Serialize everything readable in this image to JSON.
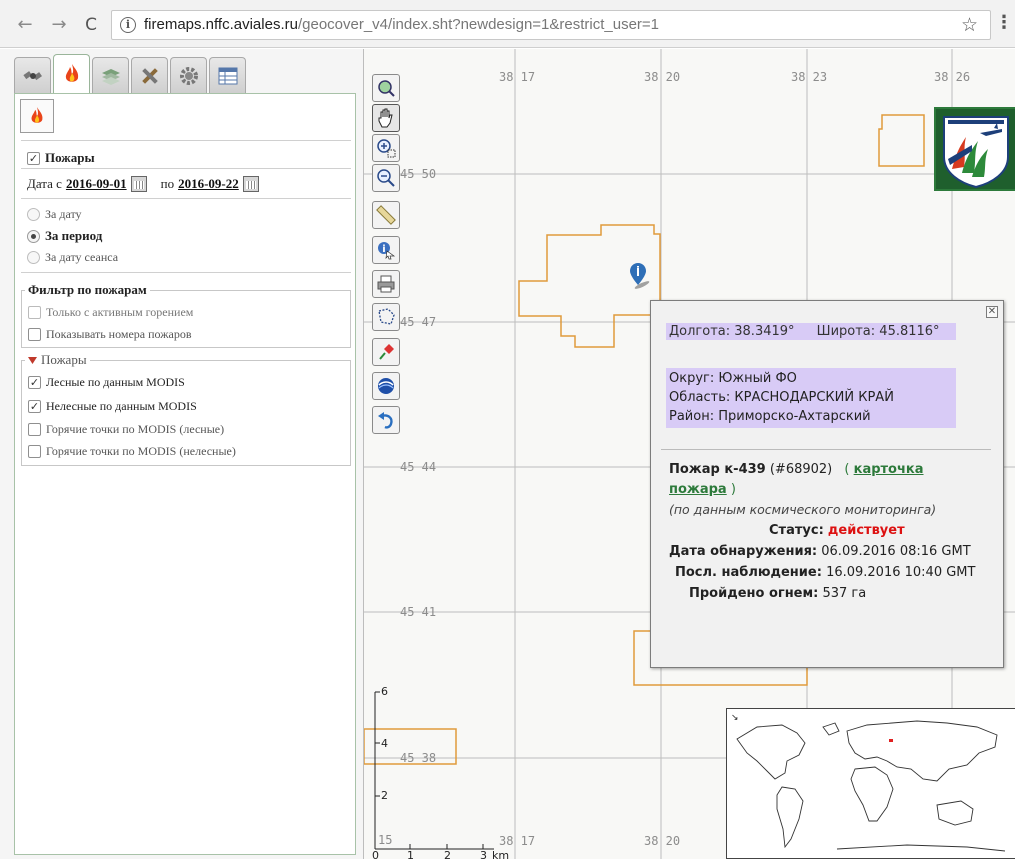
{
  "browser": {
    "url_host": "firemaps.nffc.aviales.ru",
    "url_path": "/geocover_v4/index.sht?newdesign=1&restrict_user=1"
  },
  "sidebar": {
    "tabs": [
      {
        "icon": "satellite-icon"
      },
      {
        "icon": "fire-icon",
        "active": true
      },
      {
        "icon": "layers-icon"
      },
      {
        "icon": "tools-icon"
      },
      {
        "icon": "gear-icon"
      },
      {
        "icon": "table-icon"
      }
    ],
    "fires_title": "Пожары",
    "date_from_label": "Дата с",
    "date_from": "2016-09-01",
    "date_to_label": "по",
    "date_to": "2016-09-22",
    "period_options": [
      {
        "label": "За дату",
        "selected": false
      },
      {
        "label": "За период",
        "selected": true
      },
      {
        "label": "За дату сеанса",
        "selected": false
      }
    ],
    "filter_legend": "Фильтр по пожарам",
    "filter_options": [
      {
        "label": "Только с активным горением",
        "checked": false,
        "disabled": true
      },
      {
        "label": "Показывать номера пожаров",
        "checked": false,
        "disabled": false
      }
    ],
    "fires_legend": "Пожары",
    "fire_layers": [
      {
        "label": "Лесные по данным MODIS",
        "checked": true
      },
      {
        "label": "Нелесные по данным MODIS",
        "checked": true
      },
      {
        "label": "Горячие точки по MODIS (лесные)",
        "checked": false
      },
      {
        "label": "Горячие точки по MODIS (нелесные)",
        "checked": false
      }
    ]
  },
  "map": {
    "lon_labels": [
      "38 17",
      "38 20",
      "38 23",
      "38 26"
    ],
    "lat_labels": [
      "45 50",
      "45 47",
      "45 44",
      "45 41",
      "45 38"
    ],
    "bottom_labels": [
      "38 17",
      "38 20"
    ],
    "corner_label": "15",
    "tools": [
      "zoom-extent-icon",
      "pan-hand-icon",
      "zoom-box-icon",
      "zoom-out-icon",
      "ruler-icon",
      "info-icon",
      "print-icon",
      "select-area-icon",
      "pin-icon",
      "globe-icon",
      "undo-icon"
    ],
    "scale": {
      "ticks": [
        "0",
        "1",
        "2",
        "3"
      ],
      "unit": "km",
      "vertical": [
        "6",
        "4",
        "2"
      ]
    }
  },
  "popup": {
    "lon_label": "Долгота:",
    "lon_value": "38.3419°",
    "lat_label": "Широта:",
    "lat_value": "45.8116°",
    "district": "Округ: Южный ФО",
    "region": "Область: КРАСНОДАРСКИЙ КРАЙ",
    "area": "Район: Приморско-Ахтарский",
    "fire_name": "Пожар к-439",
    "fire_id": "(#68902)",
    "card_open": "(",
    "card_link_1": "карточка",
    "card_link_2": "пожара",
    "card_close": ")",
    "source": "(по данным космического мониторинга)",
    "status_label": "Статус:",
    "status_value": "действует",
    "detected_label": "Дата обнаружения:",
    "detected_value": "06.09.2016 08:16 GMT",
    "last_obs_label": "Посл. наблюдение:",
    "last_obs_value": "16.09.2016 10:40 GMT",
    "burned_label": "Пройдено огнем:",
    "burned_value": "537 га"
  },
  "colors": {
    "fire_outline": "#e09a3b",
    "highlight": "#d8cbf6",
    "status": "#dd1111",
    "link": "#2d7a3b"
  }
}
